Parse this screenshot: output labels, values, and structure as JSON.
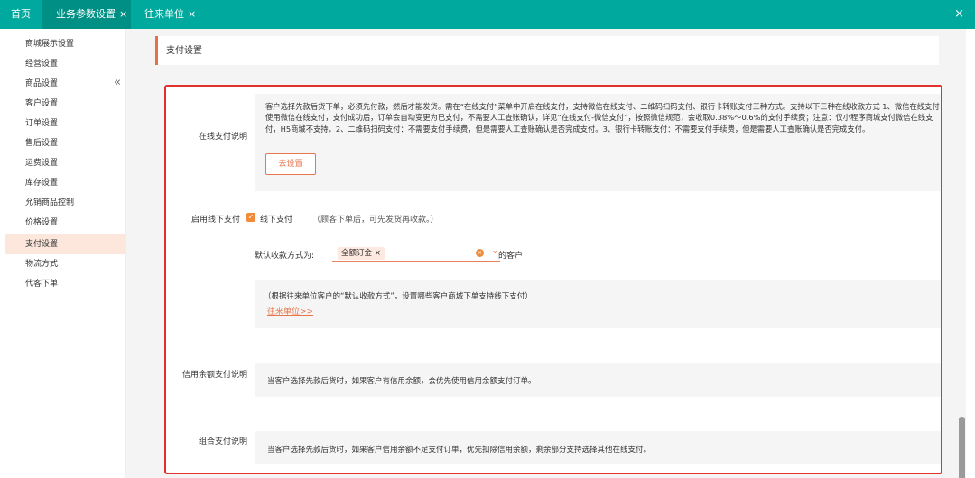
{
  "tabs": {
    "home": "首页",
    "business_params": "业务参数设置",
    "contacts": "往来单位",
    "close_glyph": "×"
  },
  "sidebar": {
    "collapse_glyph": "«",
    "items": [
      {
        "label": "商城展示设置"
      },
      {
        "label": "经营设置"
      },
      {
        "label": "商品设置"
      },
      {
        "label": "客户设置"
      },
      {
        "label": "订单设置"
      },
      {
        "label": "售后设置"
      },
      {
        "label": "运费设置"
      },
      {
        "label": "库存设置"
      },
      {
        "label": "允销商品控制"
      },
      {
        "label": "价格设置"
      },
      {
        "label": "支付设置",
        "active": true
      },
      {
        "label": "物流方式"
      },
      {
        "label": "代客下单"
      }
    ]
  },
  "page": {
    "title": "支付设置"
  },
  "online_pay": {
    "label": "在线支付说明",
    "desc": "客户选择先款后货下单，必须先付款，然后才能发货。需在“在线支付”菜单中开启在线支付，支持微信在线支付、二维码扫码支付、银行卡转账支付三种方式。支持以下三种在线收款方式 1、微信在线支付 使用微信在线支付，支付成功后，订单会自动变更为已支付，不需要人工查账确认，详见“在线支付-微信支付”，按照微信规范，会收取0.38%～0.6%的支付手续费；注意：仅小程序商城支付微信在线支付，H5商城不支持。2、二维码扫码支付：不需要支付手续费，但是需要人工查账确认是否完成支付。3、银行卡转账支付：不需要支付手续费，但是需要人工查账确认是否完成支付。",
    "button": "去设置"
  },
  "offline_pay": {
    "label": "启用线下支付",
    "check_glyph": "✓",
    "option": "线下支付",
    "hint": "（顾客下单后，可先发货再收款。）",
    "default_label": "默认收款方式为:",
    "selected_tag": "全额订金",
    "tag_close": "×",
    "clear_glyph": "×",
    "chevron": "⌄",
    "suffix": "的客户",
    "note": "（根据往来单位客户的“默认收款方式”，设置哪些客户商城下单支持线下支付）",
    "link": "往来单位>>"
  },
  "credit_pay": {
    "label": "信用余额支付说明",
    "desc": "当客户选择先款后货时，如果客户有信用余额，会优先使用信用余额支付订单。"
  },
  "combo_pay": {
    "label": "组合支付说明",
    "desc": "当客户选择先款后货时，如果客户信用余额不足支付订单，优先扣除信用余额，剩余部分支持选择其他在线支付。"
  },
  "colors": {
    "topbar": "#00a99d",
    "active_tab": "#008f84",
    "accent": "#e8764d",
    "highlight_border": "#e3312f",
    "sidebar_active": "#fde7dc"
  }
}
